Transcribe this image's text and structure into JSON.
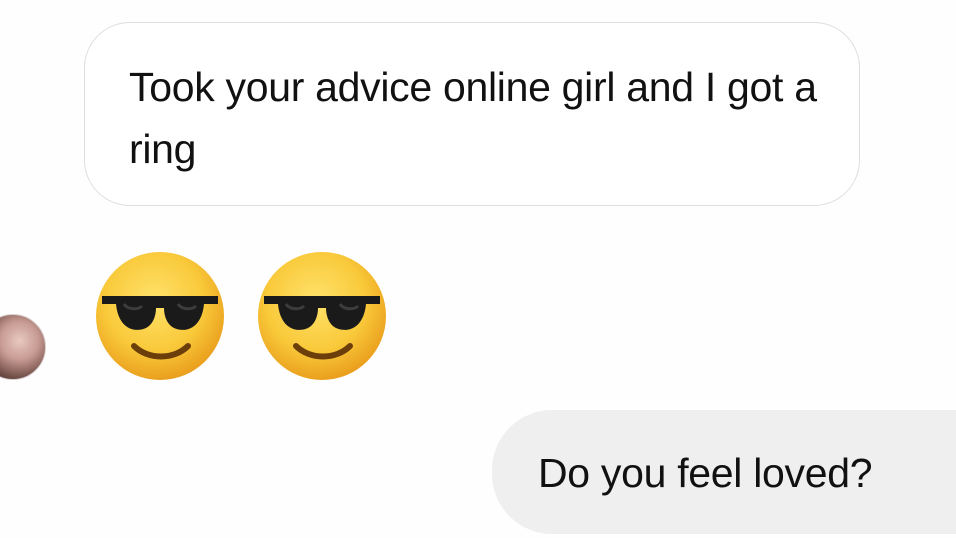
{
  "messages": {
    "incoming_text": "Took your advice online girl and I got a ring",
    "reaction_emojis": [
      "smiling-face-with-sunglasses-icon",
      "smiling-face-with-sunglasses-icon"
    ],
    "outgoing_text": "Do you feel loved?"
  },
  "colors": {
    "incoming_bubble_border": "#dedede",
    "outgoing_bubble_bg": "#efefef",
    "text": "#111111",
    "emoji_face": "#f9c93a"
  }
}
